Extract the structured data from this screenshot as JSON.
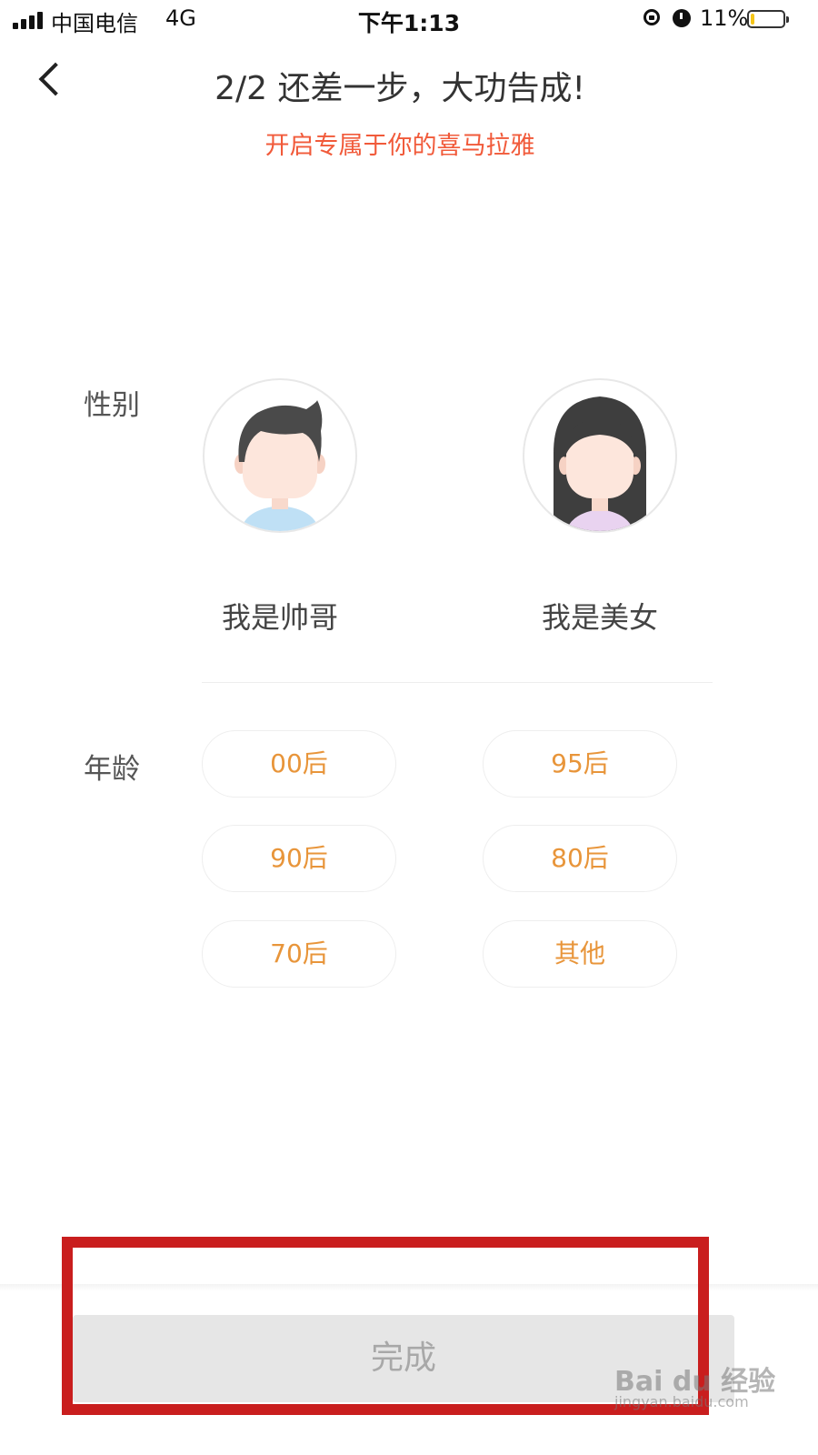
{
  "status_bar": {
    "carrier": "中国电信",
    "network": "4G",
    "time": "下午1:13",
    "battery_percent": "11%",
    "battery_level": 0.11,
    "icons": [
      "signal-icon",
      "rotation-lock-icon",
      "alarm-icon",
      "battery-icon"
    ]
  },
  "header": {
    "back_icon": "chevron-left-icon",
    "title": "2/2 还差一步，大功告成!",
    "subtitle": "开启专属于你的喜马拉雅"
  },
  "gender": {
    "label": "性别",
    "options": [
      {
        "label": "我是帅哥",
        "avatar": "male-avatar-icon"
      },
      {
        "label": "我是美女",
        "avatar": "female-avatar-icon"
      }
    ]
  },
  "age": {
    "label": "年龄",
    "options": [
      "00后",
      "95后",
      "90后",
      "80后",
      "70后",
      "其他"
    ]
  },
  "footer": {
    "done_label": "完成"
  },
  "watermark": {
    "logo_text": "Bai du 经验",
    "url": "jingyan.baidu.com"
  },
  "colors": {
    "accent_red": "#f15a3a",
    "age_text": "#e8953a",
    "highlight_box": "#c91e1e",
    "button_disabled_bg": "#e6e6e6",
    "button_disabled_text": "#a8a8a8",
    "male_hair": "#4a4a4a",
    "female_hair": "#3e3e3e",
    "skin": "#fde6dc",
    "male_shirt": "#bfe0f5",
    "female_shirt": "#e9d3f0"
  }
}
